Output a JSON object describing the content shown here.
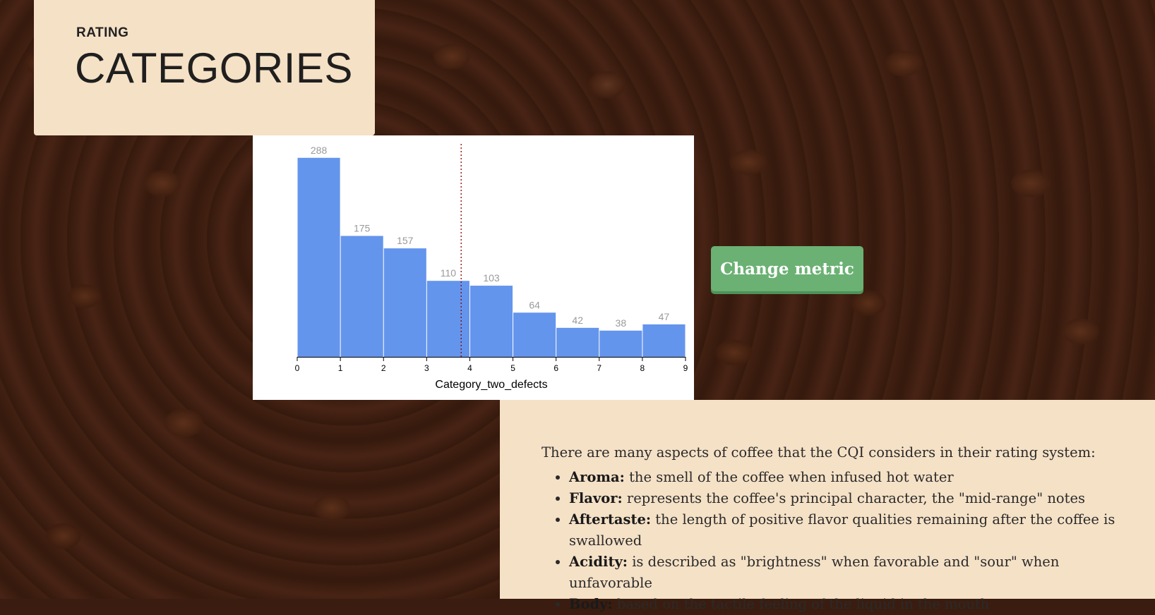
{
  "title_panel": {
    "eyebrow": "RATING",
    "headline": "CATEGORIES"
  },
  "change_metric_button": "Change metric",
  "description": {
    "intro": "There are many aspects of coffee that the CQI considers in their rating system:",
    "aspects": [
      {
        "term": "Aroma:",
        "text": " the smell of the coffee when infused hot water"
      },
      {
        "term": "Flavor:",
        "text": " represents the coffee's principal character, the \"mid-range\" notes"
      },
      {
        "term": "Aftertaste:",
        "text": " the length of positive flavor qualities remaining after the coffee is swallowed"
      },
      {
        "term": "Acidity:",
        "text": " is described as \"brightness\" when favorable and \"sour\" when unfavorable"
      },
      {
        "term": "Body:",
        "text": " based on the tactile feeling of the liquid in the mouth"
      }
    ]
  },
  "colors": {
    "panel": "#f5e1c6",
    "bar": "#6495ed",
    "button": "#6bb173",
    "mean_line": "#8b0000"
  },
  "chart_data": {
    "type": "bar",
    "xlabel": "Category_two_defects",
    "bins": [
      0,
      1,
      2,
      3,
      4,
      5,
      6,
      7,
      8,
      9
    ],
    "values": [
      288,
      175,
      157,
      110,
      103,
      64,
      42,
      38,
      47
    ],
    "xticks": [
      "0",
      "1",
      "2",
      "3",
      "4",
      "5",
      "6",
      "7",
      "8",
      "9"
    ],
    "xlim": [
      0,
      9
    ],
    "ylim": [
      0,
      300
    ],
    "mean_line_x": 3.8,
    "grid": false
  }
}
